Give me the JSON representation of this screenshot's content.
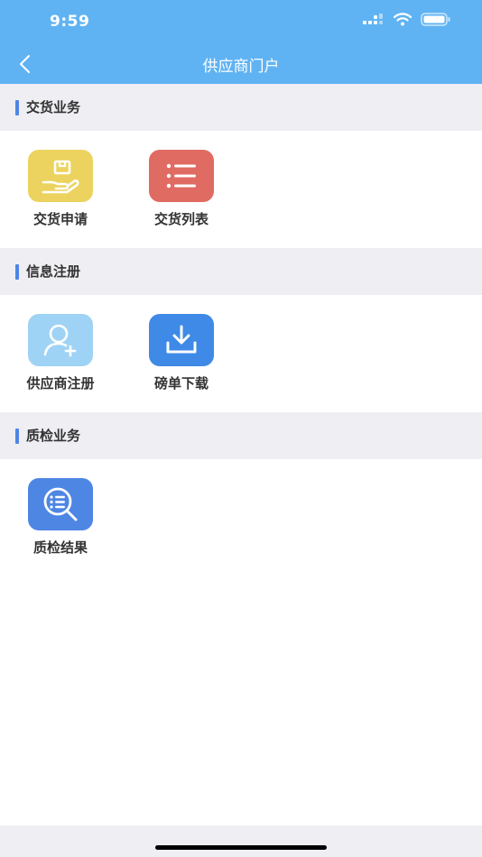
{
  "status_bar": {
    "time": "9:59"
  },
  "nav": {
    "title": "供应商门户"
  },
  "sections": [
    {
      "title": "交货业务",
      "items": [
        {
          "label": "交货申请",
          "icon": "package-hand-icon",
          "color": "#ecd35f"
        },
        {
          "label": "交货列表",
          "icon": "list-icon",
          "color": "#e06b62"
        }
      ]
    },
    {
      "title": "信息注册",
      "items": [
        {
          "label": "供应商注册",
          "icon": "add-user-icon",
          "color": "#9fd3f5"
        },
        {
          "label": "磅单下载",
          "icon": "download-icon",
          "color": "#3e8ae6"
        }
      ]
    },
    {
      "title": "质检业务",
      "items": [
        {
          "label": "质检结果",
          "icon": "search-list-icon",
          "color": "#4e86e4"
        }
      ]
    }
  ]
}
